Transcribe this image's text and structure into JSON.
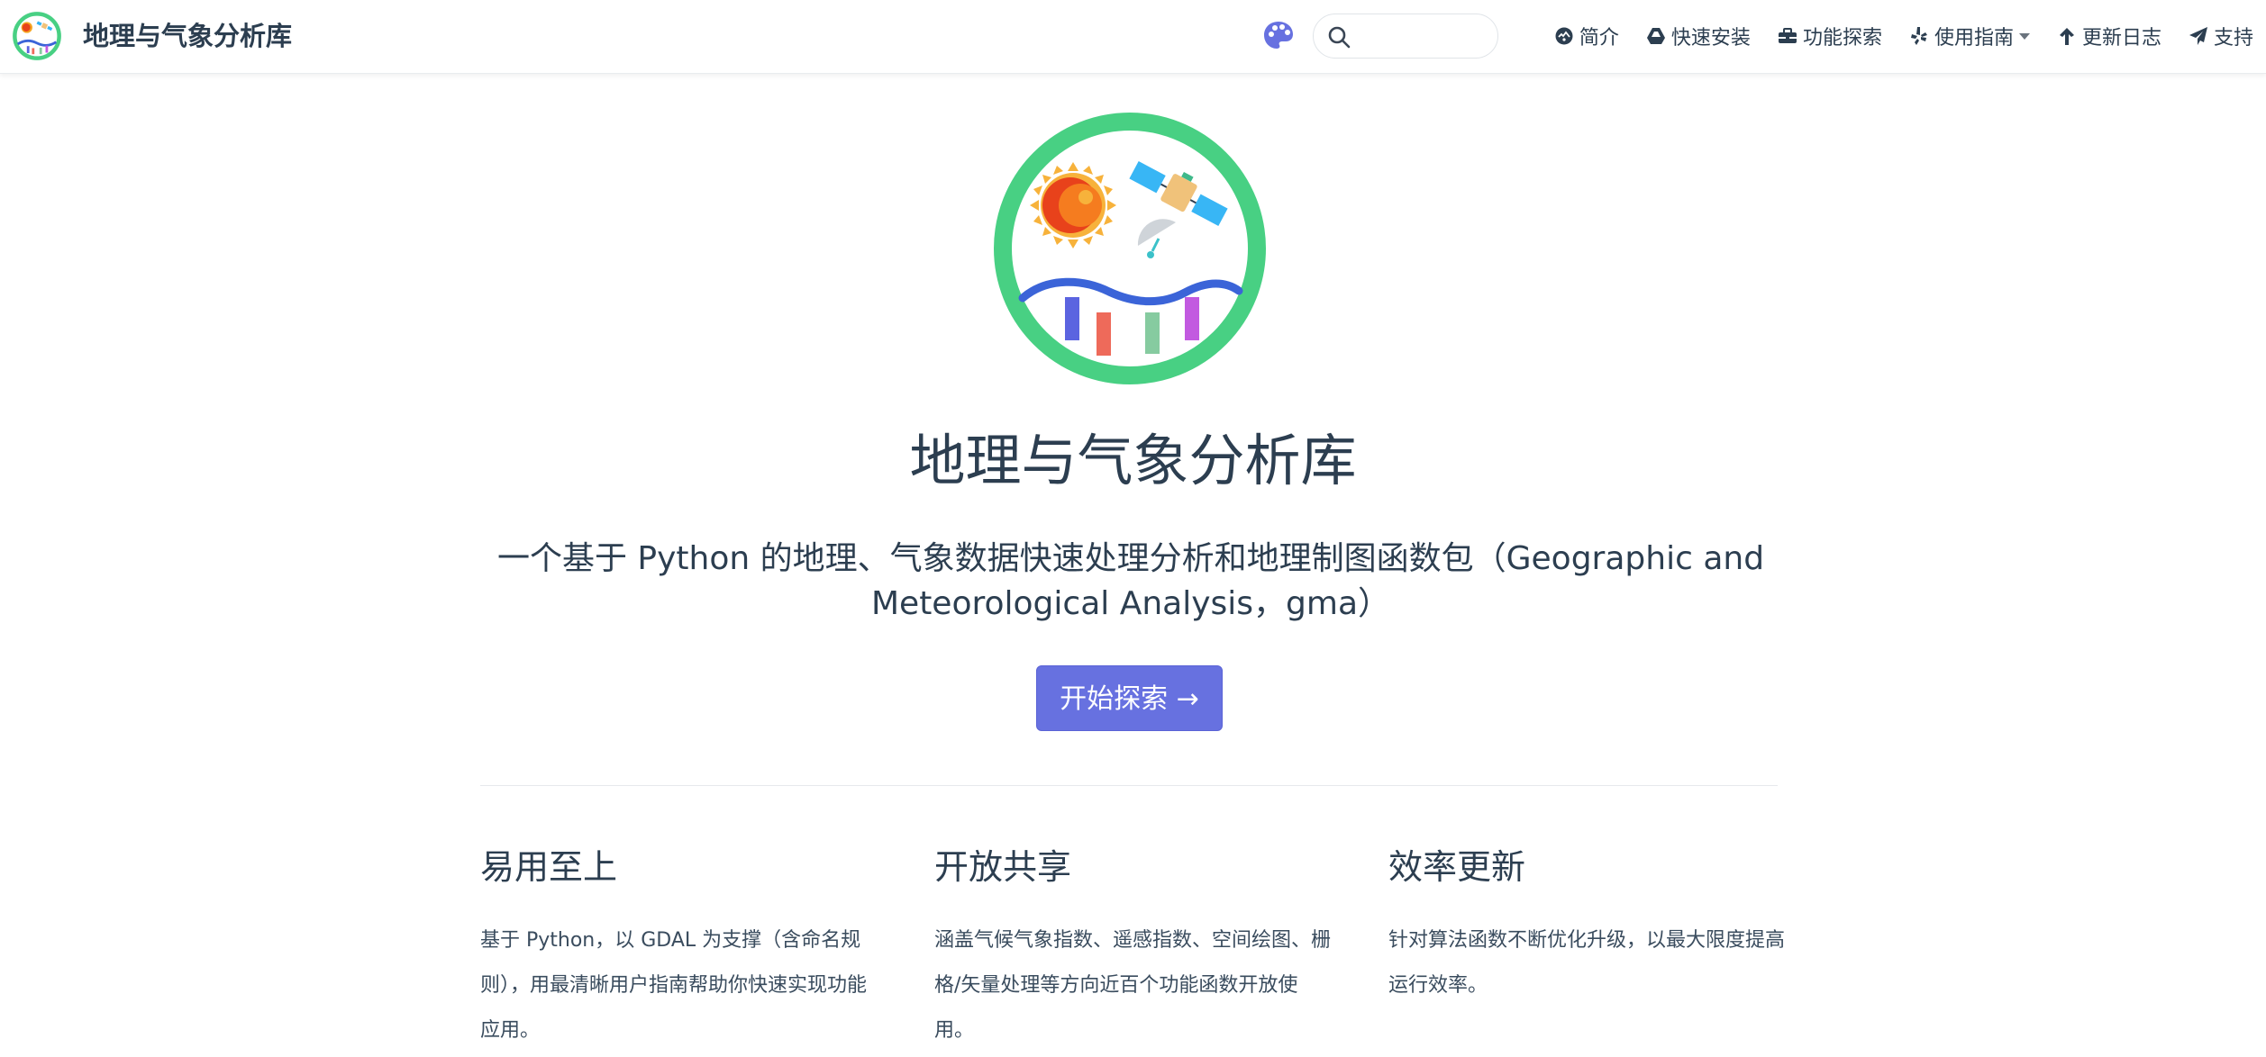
{
  "navbar": {
    "brand_title": "地理与气象分析库",
    "search": {
      "value": "",
      "placeholder": ""
    },
    "links": [
      {
        "label": "简介",
        "icon": "globe-icon"
      },
      {
        "label": "快速安装",
        "icon": "drive-icon"
      },
      {
        "label": "功能探索",
        "icon": "toolbox-icon"
      },
      {
        "label": "使用指南",
        "icon": "yelp-icon",
        "dropdown": true
      },
      {
        "label": "更新日志",
        "icon": "arrow-up-icon"
      },
      {
        "label": "支持",
        "icon": "paper-plane-icon"
      }
    ]
  },
  "hero": {
    "title": "地理与气象分析库",
    "description": "一个基于 Python 的地理、气象数据快速处理分析和地理制图函数包（Geographic and Meteorological Analysis，gma）",
    "action_label": "开始探索 →"
  },
  "features": [
    {
      "title": "易用至上",
      "details": "基于 Python，以 GDAL 为支撑（含命名规则），用最清晰用户指南帮助你快速实现功能应用。"
    },
    {
      "title": "开放共享",
      "details": "涵盖气候气象指数、遥感指数、空间绘图、栅格/矢量处理等方向近百个功能函数开放使用。"
    },
    {
      "title": "效率更新",
      "details": "针对算法函数不断优化升级，以最大限度提高运行效率。"
    }
  ],
  "colors": {
    "accent": "#6771e0",
    "logo_ring": "#48d083",
    "text": "#2c3e50"
  }
}
